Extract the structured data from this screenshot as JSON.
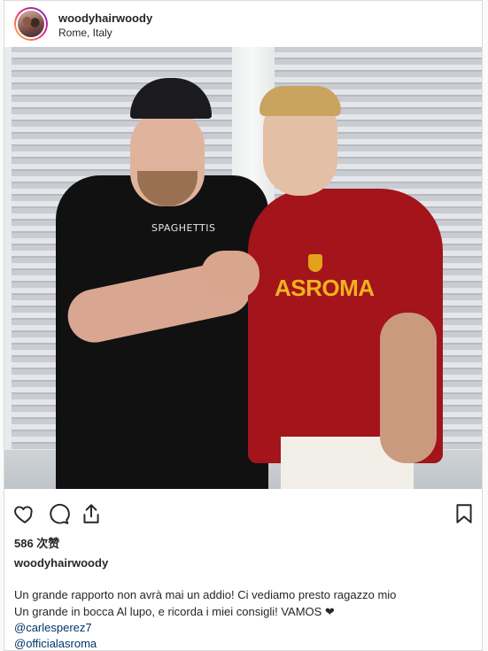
{
  "post": {
    "username": "woodyhairwoody",
    "location": "Rome, Italy",
    "likes": "586 次赞",
    "caption_username": "woodyhairwoody",
    "caption_lines": [
      "Un grande rapporto non avrà mai un addio! Ci vediamo presto ragazzo mio",
      "Un grande in bocca Al lupo, e ricorda i miei consigli! VAMOS ❤"
    ],
    "mentions": [
      "@carlesperez7",
      "@officialasroma"
    ]
  },
  "photo": {
    "shirt_print": "SPAGHETTIS",
    "shirt_club_text": "ASROMA"
  },
  "icons": {
    "like": "heart-icon",
    "comment": "comment-icon",
    "share": "share-icon",
    "save": "bookmark-icon"
  },
  "colors": {
    "border": "#dbdbdb",
    "text": "#262626",
    "mention": "#00376b",
    "roma_red": "#a3141b",
    "roma_gold": "#f0b21f"
  }
}
